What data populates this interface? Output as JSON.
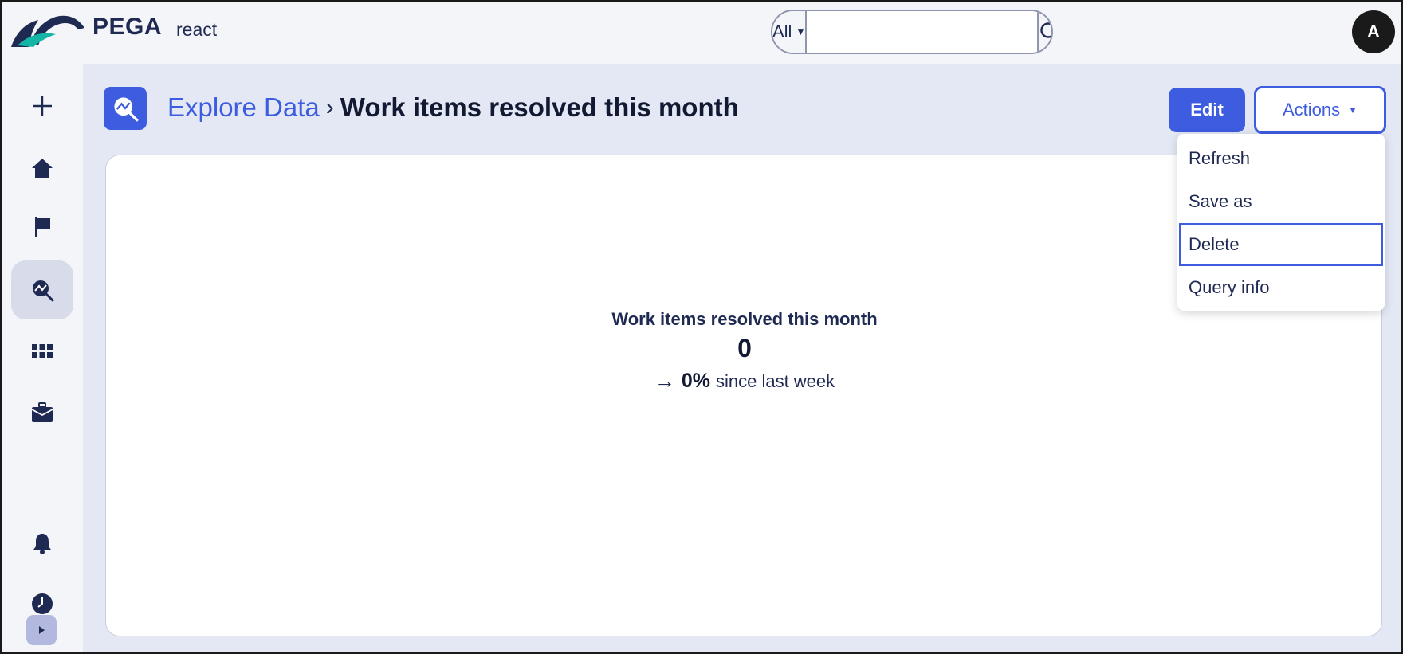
{
  "header": {
    "brand": "PEGA",
    "brand_sub": "react",
    "search": {
      "scope": "All",
      "placeholder": ""
    },
    "avatar_initial": "A"
  },
  "sidebar": {
    "items": [
      {
        "icon": "plus-icon"
      },
      {
        "icon": "home-icon"
      },
      {
        "icon": "flag-icon"
      },
      {
        "icon": "explore-data-icon",
        "active": true
      },
      {
        "icon": "apps-grid-icon"
      },
      {
        "icon": "briefcase-icon"
      },
      {
        "icon": "bell-icon"
      },
      {
        "icon": "clock-icon"
      }
    ],
    "expand_icon": "chevron-right-icon"
  },
  "breadcrumb": {
    "parent": "Explore Data",
    "separator": "›",
    "current": "Work items resolved this month"
  },
  "toolbar": {
    "edit_label": "Edit",
    "actions_label": "Actions"
  },
  "kpi": {
    "title": "Work items resolved this month",
    "value": "0",
    "trend_arrow": "→",
    "change": "0%",
    "change_suffix": "since last week"
  },
  "actions_menu": {
    "items": [
      "Refresh",
      "Save as",
      "Delete",
      "Query info"
    ],
    "focused_index": 2
  },
  "colors": {
    "accent": "#3d5ce0",
    "navy": "#1f2a53",
    "main_bg": "#e3e8f4",
    "header_bg": "#f4f5f9"
  }
}
